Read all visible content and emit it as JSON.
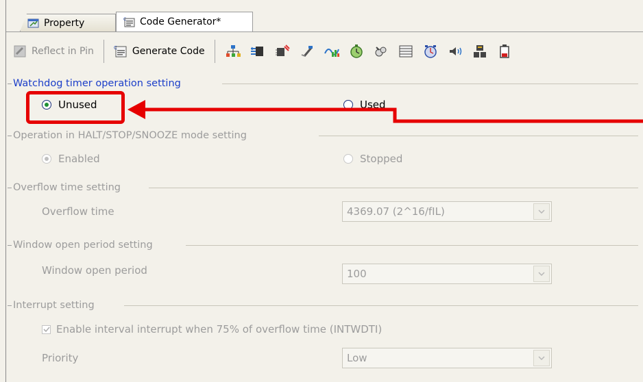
{
  "tabs": [
    {
      "label": "Property",
      "icon": "property-icon"
    },
    {
      "label": "Code Generator*",
      "icon": "code-generator-icon"
    }
  ],
  "toolbar": {
    "reflect_label": "Reflect in Pin",
    "generate_label": "Generate Code",
    "peripheral_icons": [
      "clock-generator-icon",
      "port-icon",
      "timer-array-icon",
      "rtc-icon",
      "interval-timer-icon",
      "watchdog-icon",
      "buzzer-icon",
      "adc-icon",
      "serial-icon",
      "sound-icon",
      "dma-icon",
      "battery-icon"
    ]
  },
  "groups": {
    "wdt_operation": {
      "title": "Watchdog timer operation setting",
      "options": [
        {
          "label": "Unused",
          "selected": true
        },
        {
          "label": "Used",
          "selected": false
        }
      ]
    },
    "halt_mode": {
      "title": "Operation in HALT/STOP/SNOOZE mode setting",
      "options": [
        {
          "label": "Enabled",
          "selected": true
        },
        {
          "label": "Stopped",
          "selected": false
        }
      ]
    },
    "overflow": {
      "title": "Overflow time setting",
      "field_label": "Overflow time",
      "value": "4369.07 (2^16/fIL)"
    },
    "window": {
      "title": "Window open period setting",
      "field_label": "Window open period",
      "value": "100"
    },
    "interrupt": {
      "title": "Interrupt setting",
      "checkbox_label": "Enable interval interrupt when 75% of overflow time (INTWDTI)",
      "checked": true,
      "priority_label": "Priority",
      "priority_value": "Low"
    }
  },
  "colors": {
    "active_title": "#1b3ec9",
    "annotation": "#e60000",
    "disabled_text": "#9c9c9c"
  }
}
